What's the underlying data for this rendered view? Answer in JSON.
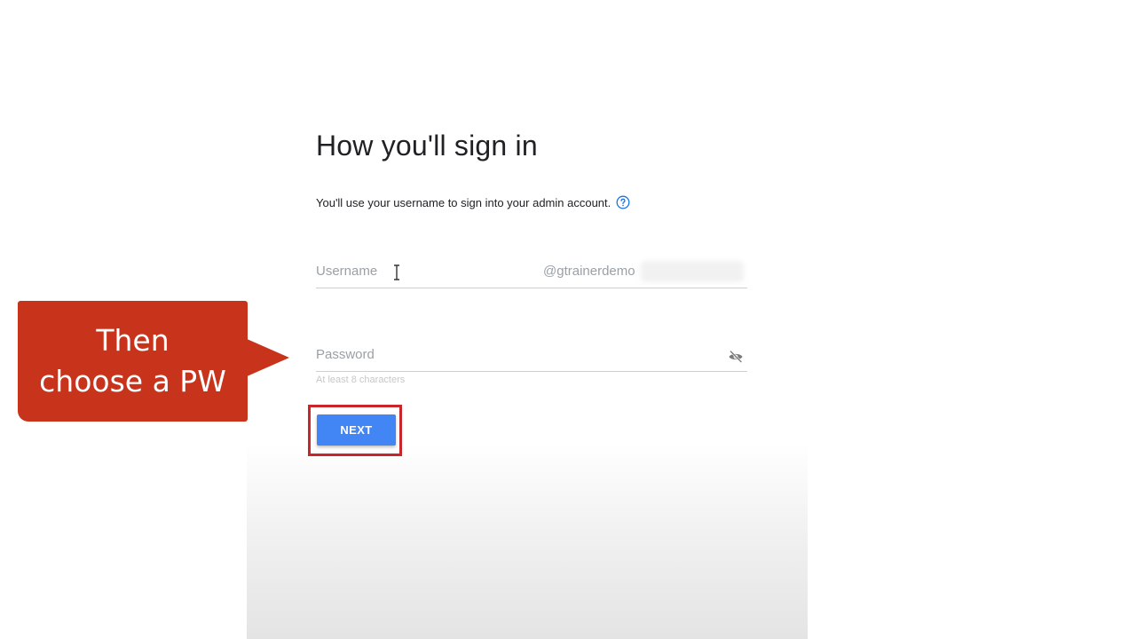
{
  "form": {
    "title": "How you'll sign in",
    "subtitle": "You'll use your username to sign into your admin account.",
    "help_icon": "help-circle-icon",
    "username": {
      "placeholder": "Username",
      "domain_suffix": "@gtrainerdemo"
    },
    "password": {
      "placeholder": "Password",
      "hint": "At least 8 characters",
      "toggle_icon": "eye-off-icon"
    },
    "next_label": "NEXT"
  },
  "callout": {
    "text_line1": "Then",
    "text_line2": "choose a PW"
  },
  "colors": {
    "primary_button": "#4285f4",
    "callout_bg": "#c8331b",
    "highlight_border": "#c8262b",
    "help_icon": "#1a73e8"
  }
}
